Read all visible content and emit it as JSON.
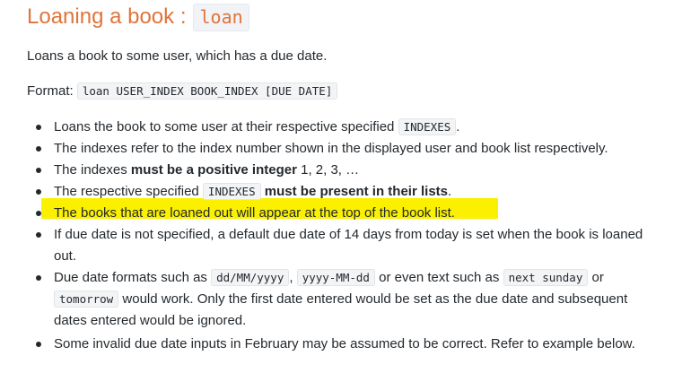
{
  "heading": {
    "text": "Loaning a book :",
    "code": "loan"
  },
  "intro": "Loans a book to some user, which has a due date.",
  "format": {
    "label": "Format:",
    "code": "loan USER_INDEX BOOK_INDEX [DUE DATE]"
  },
  "bullets": [
    {
      "text_before": "Loans the book to some user at their respective specified",
      "code": "INDEXES",
      "text_after": "."
    },
    {
      "text": "The indexes refer to the index number shown in the displayed user and book list respectively."
    },
    {
      "text_before": "The indexes",
      "bold": "must be a positive integer",
      "text_after": "1, 2, 3, …"
    },
    {
      "text_before": "The respective specified",
      "code": "INDEXES",
      "bold": "must be present in their lists",
      "text_after": "."
    },
    {
      "text": "The books that are loaned out will appear at the top of the book list.",
      "highlighted": true
    },
    {
      "line1": "If due date is not specified, a default due date of 14 days from today is set when the book is loaned",
      "line2": "out."
    },
    {
      "t1": "Due date formats such as",
      "c1": "dd/MM/yyyy",
      "t2": ",",
      "c2": "yyyy-MM-dd",
      "t3": "or even text such as",
      "c3": "next sunday",
      "t4": "or",
      "c4": "tomorrow",
      "t5": "would work. Only the first date entered would be set as the due date and subsequent",
      "t6": "dates entered would be ignored."
    },
    {
      "text": "Some invalid due date inputs in February may be assumed to be correct. Refer to example below."
    }
  ],
  "colors": {
    "heading": "#e0743a",
    "highlight": "#fbf000",
    "text": "#24292e",
    "code_bg": "#f3f4f6"
  }
}
